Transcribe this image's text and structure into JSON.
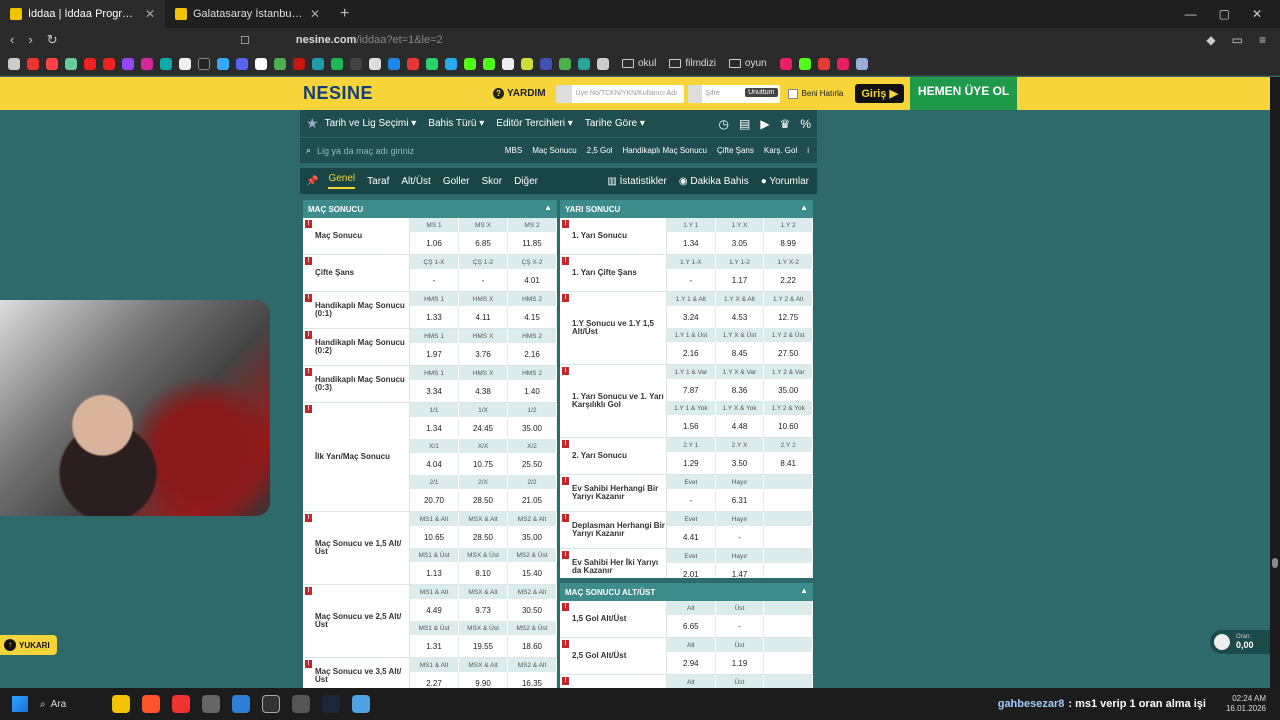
{
  "browser": {
    "tabs": [
      {
        "title": "İddaa | İddaa Programı | Canlı İddaa",
        "active": true
      },
      {
        "title": "Galatasaray İstanbul - Gaziantep FK",
        "active": false
      }
    ],
    "url_host": "nesine.com",
    "url_path": "/iddaa?et=1&le=2",
    "bookmarks_folders": [
      "okul",
      "filmdizi",
      "oyun"
    ]
  },
  "header": {
    "logo": "NESINE",
    "help": "YARDIM",
    "login_placeholder": "Üye No/TCKN/YKN/Kullanıcı Adı",
    "password_placeholder": "Şifre",
    "forgot": "Unuttum",
    "remember": "Beni Hatırla",
    "login_button": "Giriş",
    "register_button": "HEMEN ÜYE OL"
  },
  "filterbar": {
    "items": [
      "Tarih ve Lig Seçimi",
      "Bahis Türü",
      "Editör Tercihleri",
      "Tarihe Göre"
    ]
  },
  "searchrow": {
    "placeholder": "Lig ya da maç adı giriniz",
    "columns": [
      "MBS",
      "Maç Sonucu",
      "2,5 Gol",
      "Handikaplı Maç Sonucu",
      "Çifte Şans",
      "Karş. Gol"
    ]
  },
  "tabs": {
    "items": [
      "Genel",
      "Taraf",
      "Alt/Üst",
      "Goller",
      "Skor",
      "Diğer"
    ],
    "right": [
      "İstatistikler",
      "Dakika Bahis",
      "Yorumlar"
    ]
  },
  "left_panel": {
    "title": "MAÇ SONUCU",
    "markets": [
      {
        "label": "Maç Sonucu",
        "groups": [
          {
            "heads": [
              "MS 1",
              "MS X",
              "MS 2"
            ],
            "odds": [
              "1.06",
              "6.85",
              "11.85"
            ]
          }
        ]
      },
      {
        "label": "Çifte Şans",
        "groups": [
          {
            "heads": [
              "ÇŞ 1-X",
              "ÇŞ 1-2",
              "ÇŞ X-2"
            ],
            "odds": [
              "-",
              "-",
              "4.01"
            ]
          }
        ]
      },
      {
        "label": "Handikaplı Maç Sonucu (0:1)",
        "groups": [
          {
            "heads": [
              "HMS 1",
              "HMS X",
              "HMS 2"
            ],
            "odds": [
              "1.33",
              "4.11",
              "4.15"
            ]
          }
        ]
      },
      {
        "label": "Handikaplı Maç Sonucu (0:2)",
        "groups": [
          {
            "heads": [
              "HMS 1",
              "HMS X",
              "HMS 2"
            ],
            "odds": [
              "1.97",
              "3.76",
              "2.16"
            ]
          }
        ]
      },
      {
        "label": "Handikaplı Maç Sonucu (0:3)",
        "groups": [
          {
            "heads": [
              "HMS 1",
              "HMS X",
              "HMS 2"
            ],
            "odds": [
              "3.34",
              "4.38",
              "1.40"
            ]
          }
        ]
      },
      {
        "label": "İlk Yarı/Maç Sonucu",
        "groups": [
          {
            "heads": [
              "1/1",
              "1/X",
              "1/2"
            ],
            "odds": [
              "1.34",
              "24.45",
              "35.00"
            ]
          },
          {
            "heads": [
              "X/1",
              "X/X",
              "X/2"
            ],
            "odds": [
              "4.04",
              "10.75",
              "25.50"
            ]
          },
          {
            "heads": [
              "2/1",
              "2/X",
              "2/2"
            ],
            "odds": [
              "20.70",
              "28.50",
              "21.05"
            ]
          }
        ]
      },
      {
        "label": "Maç Sonucu ve 1,5 Alt/Üst",
        "groups": [
          {
            "heads": [
              "MS1 & Alt",
              "MSX & Alt",
              "MS2 & Alt"
            ],
            "odds": [
              "10.65",
              "28.50",
              "35.00"
            ]
          },
          {
            "heads": [
              "MS1 & Üst",
              "MSX & Üst",
              "MS2 & Üst"
            ],
            "odds": [
              "1.13",
              "8.10",
              "15.40"
            ]
          }
        ]
      },
      {
        "label": "Maç Sonucu ve 2,5 Alt/Üst",
        "groups": [
          {
            "heads": [
              "MS1 & Alt",
              "MSX & Alt",
              "MS2 & Alt"
            ],
            "odds": [
              "4.49",
              "9.73",
              "30.50"
            ]
          },
          {
            "heads": [
              "MS1 & Üst",
              "MSX & Üst",
              "MS2 & Üst"
            ],
            "odds": [
              "1.31",
              "19.55",
              "18.60"
            ]
          }
        ]
      },
      {
        "label": "Maç Sonucu ve 3,5 Alt/Üst",
        "groups": [
          {
            "heads": [
              "MS1 & Alt",
              "MSX & Alt",
              "MS2 & Alt"
            ],
            "odds": [
              "2.27",
              "9.90",
              "16.35"
            ]
          }
        ]
      }
    ]
  },
  "right_panel": {
    "title": "YARI SONUCU",
    "markets": [
      {
        "label": "1. Yarı Sonucu",
        "groups": [
          {
            "heads": [
              "1.Y 1",
              "1.Y X",
              "1.Y 2"
            ],
            "odds": [
              "1.34",
              "3.05",
              "8.99"
            ]
          }
        ]
      },
      {
        "label": "1. Yarı Çifte Şans",
        "groups": [
          {
            "heads": [
              "1.Y 1-X",
              "1.Y 1-2",
              "1.Y X-2"
            ],
            "odds": [
              "-",
              "1.17",
              "2.22"
            ]
          }
        ]
      },
      {
        "label": "1.Y Sonucu ve 1.Y 1,5 Alt/Üst",
        "groups": [
          {
            "heads": [
              "1.Y 1 & Alt",
              "1.Y X & Alt",
              "1.Y 2 & Alt"
            ],
            "odds": [
              "3.24",
              "4.53",
              "12.75"
            ]
          },
          {
            "heads": [
              "1.Y 1 & Üst",
              "1.Y X & Üst",
              "1.Y 2 & Üst"
            ],
            "odds": [
              "2.16",
              "8.45",
              "27.50"
            ]
          }
        ]
      },
      {
        "label": "1. Yarı Sonucu ve 1. Yarı Karşılıklı Gol",
        "groups": [
          {
            "heads": [
              "1.Y 1 & Var",
              "1.Y X & Var",
              "1.Y 2 & Var"
            ],
            "odds": [
              "7.87",
              "8.36",
              "35.00"
            ]
          },
          {
            "heads": [
              "1.Y 1 & Yok",
              "1.Y X & Yok",
              "1.Y 2 & Yok"
            ],
            "odds": [
              "1.56",
              "4.48",
              "10.60"
            ]
          }
        ]
      },
      {
        "label": "2. Yarı Sonucu",
        "groups": [
          {
            "heads": [
              "2.Y 1",
              "2.Y X",
              "2.Y 2"
            ],
            "odds": [
              "1.29",
              "3.50",
              "8.41"
            ]
          }
        ]
      },
      {
        "label": "Ev Sahibi Herhangi Bir Yarıyı Kazanır",
        "groups": [
          {
            "heads": [
              "Evet",
              "Hayır",
              ""
            ],
            "odds": [
              "-",
              "6.31",
              ""
            ]
          }
        ]
      },
      {
        "label": "Deplasman Herhangi Bir Yarıyı Kazanır",
        "groups": [
          {
            "heads": [
              "Evet",
              "Hayır",
              ""
            ],
            "odds": [
              "4.41",
              "-",
              ""
            ]
          }
        ]
      },
      {
        "label": "Ev Sahibi Her İki Yarıyı da Kazanır",
        "groups": [
          {
            "heads": [
              "Evet",
              "Hayır",
              ""
            ],
            "odds": [
              "2.01",
              "1.47",
              ""
            ]
          }
        ]
      }
    ]
  },
  "right_panel2": {
    "title": "MAÇ SONUCU ALT/ÜST",
    "markets": [
      {
        "label": "1,5 Gol Alt/Üst",
        "groups": [
          {
            "heads": [
              "Alt",
              "Üst",
              ""
            ],
            "odds": [
              "6.65",
              "-",
              ""
            ]
          }
        ]
      },
      {
        "label": "2,5 Gol Alt/Üst",
        "groups": [
          {
            "heads": [
              "Alt",
              "Üst",
              ""
            ],
            "odds": [
              "2.94",
              "1.19",
              ""
            ]
          }
        ]
      },
      {
        "label": "",
        "groups": [
          {
            "heads": [
              "Alt",
              "Üst",
              ""
            ],
            "odds": [
              "",
              "",
              ""
            ]
          }
        ]
      }
    ]
  },
  "floating": {
    "up_button": "YUKARI",
    "coupon_label": "Oran:",
    "coupon_value": "0,00",
    "coupon_count": "0"
  },
  "taskbar": {
    "search": "Ara",
    "chat_user": "gahbesezar8",
    "chat_message": ": ms1 verip 1 oran alma işi",
    "time": "02:24 AM",
    "date": "16.01.2026"
  }
}
